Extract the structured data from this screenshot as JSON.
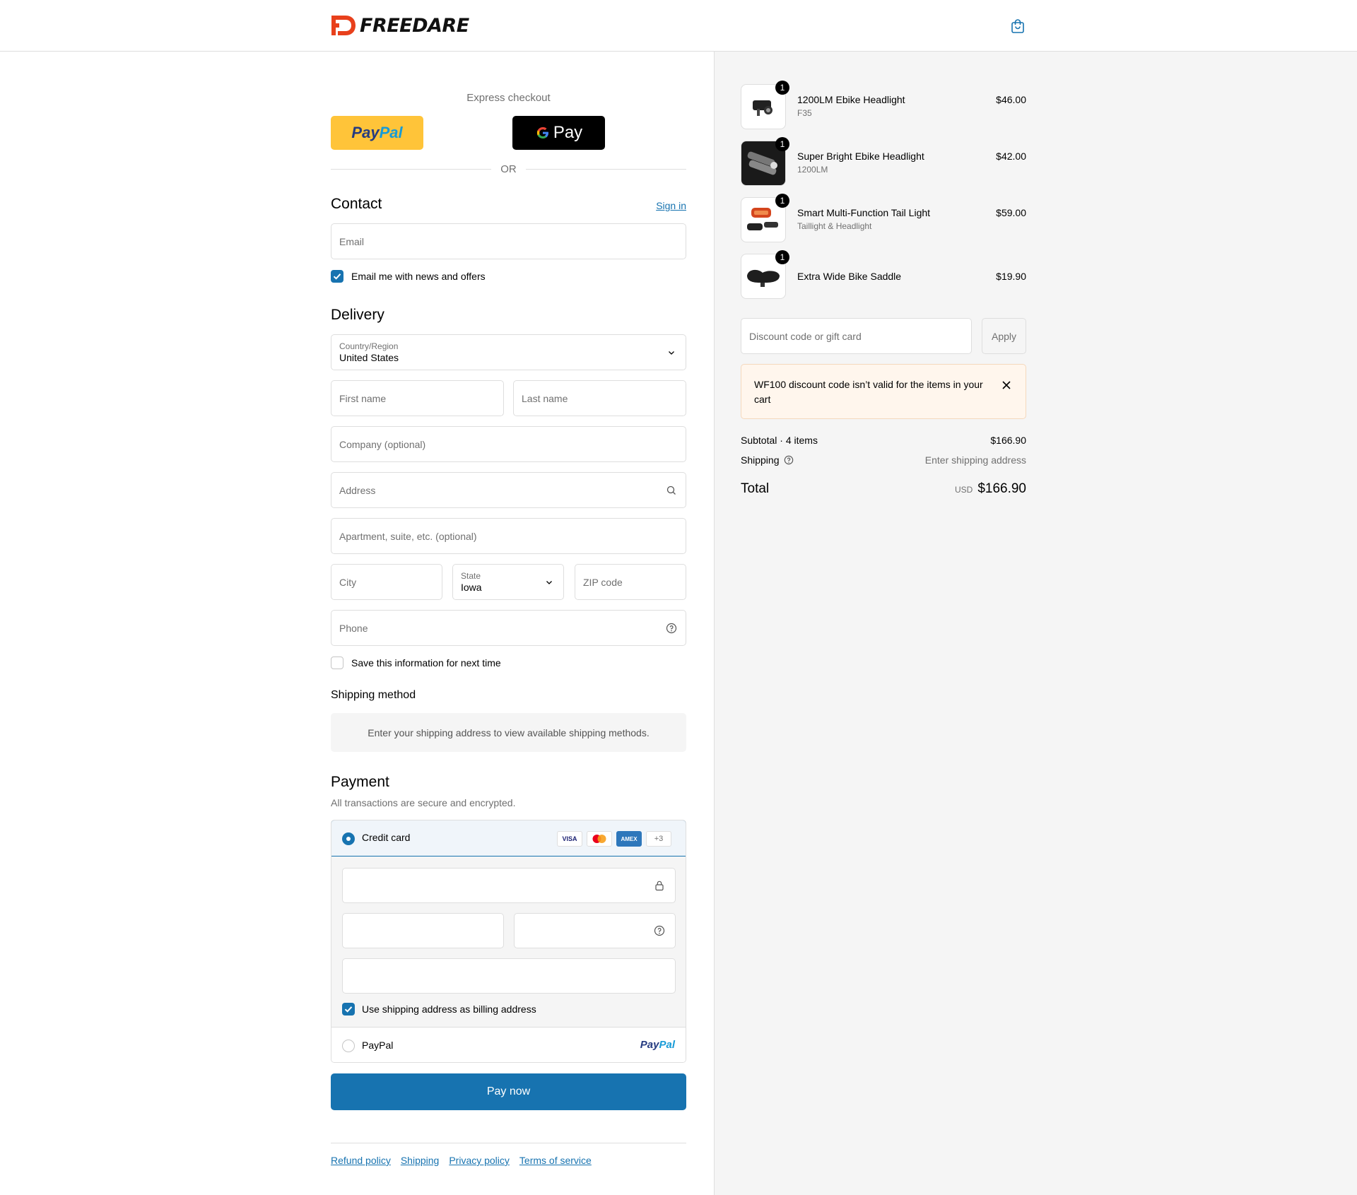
{
  "brand": {
    "name": "FREEDARE",
    "accent": "#1773b0"
  },
  "header": {
    "cart_icon": "shopping-bag-icon"
  },
  "express": {
    "title": "Express checkout",
    "paypal_label_1": "Pay",
    "paypal_label_2": "Pal",
    "gpay_label": "Pay",
    "or_label": "OR"
  },
  "contact": {
    "title": "Contact",
    "sign_in": "Sign in",
    "email_placeholder": "Email",
    "newsletter_label": "Email me with news and offers",
    "newsletter_checked": true
  },
  "delivery": {
    "title": "Delivery",
    "country_label": "Country/Region",
    "country_value": "United States",
    "first_name": "First name",
    "last_name": "Last name",
    "company": "Company (optional)",
    "address": "Address",
    "apartment": "Apartment, suite, etc. (optional)",
    "city": "City",
    "state_label": "State",
    "state_value": "Iowa",
    "zip": "ZIP code",
    "phone": "Phone",
    "save_info_label": "Save this information for next time",
    "save_info_checked": false
  },
  "shipping_method": {
    "title": "Shipping method",
    "notice": "Enter your shipping address to view available shipping methods."
  },
  "payment": {
    "title": "Payment",
    "subtitle": "All transactions are secure and encrypted.",
    "credit_card_label": "Credit card",
    "card_badges": [
      "VISA",
      "",
      "AMEX",
      "+3"
    ],
    "billing_label": "Use shipping address as billing address",
    "billing_checked": true,
    "paypal_label": "PayPal",
    "paypal_logo_1": "Pay",
    "paypal_logo_2": "Pal",
    "pay_now": "Pay now"
  },
  "footer": {
    "links": [
      "Refund policy",
      "Shipping",
      "Privacy policy",
      "Terms of service"
    ]
  },
  "cart": {
    "items": [
      {
        "name": "1200LM Ebike Headlight",
        "variant": "F35",
        "price": "$46.00",
        "qty": "1"
      },
      {
        "name": "Super Bright Ebike Headlight",
        "variant": "1200LM",
        "price": "$42.00",
        "qty": "1"
      },
      {
        "name": "Smart Multi-Function Tail Light",
        "variant": "Taillight & Headlight",
        "price": "$59.00",
        "qty": "1"
      },
      {
        "name": "Extra Wide Bike Saddle",
        "variant": "",
        "price": "$19.90",
        "qty": "1"
      }
    ],
    "discount_placeholder": "Discount code or gift card",
    "apply_label": "Apply",
    "error_message": "WF100 discount code isn’t valid for the items in your cart",
    "subtotal_label": "Subtotal · 4 items",
    "subtotal_value": "$166.90",
    "shipping_label": "Shipping",
    "shipping_value": "Enter shipping address",
    "total_label": "Total",
    "total_currency": "USD",
    "total_value": "$166.90"
  }
}
